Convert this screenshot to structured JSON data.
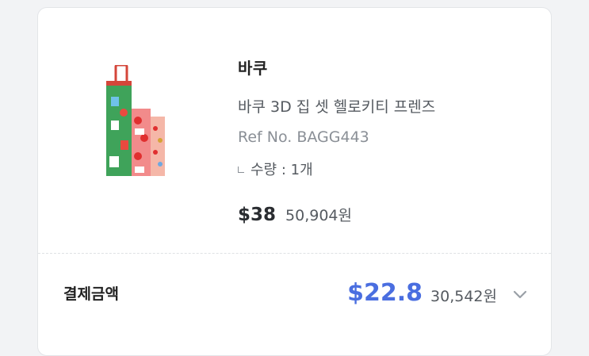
{
  "product": {
    "brand": "바쿠",
    "name": "바쿠 3D 집 셋 헬로키티 프렌즈",
    "ref": "Ref No. BAGG443",
    "quantity": "수량 : 1개",
    "price_usd": "$38",
    "price_krw": "50,904원",
    "image_icon": "bag-set-thumbnail"
  },
  "payment": {
    "label": "결제금액",
    "amount_usd": "$22.8",
    "amount_krw": "30,542원",
    "expand_icon": "chevron-down-icon",
    "accent_color": "#4a6ee0"
  }
}
